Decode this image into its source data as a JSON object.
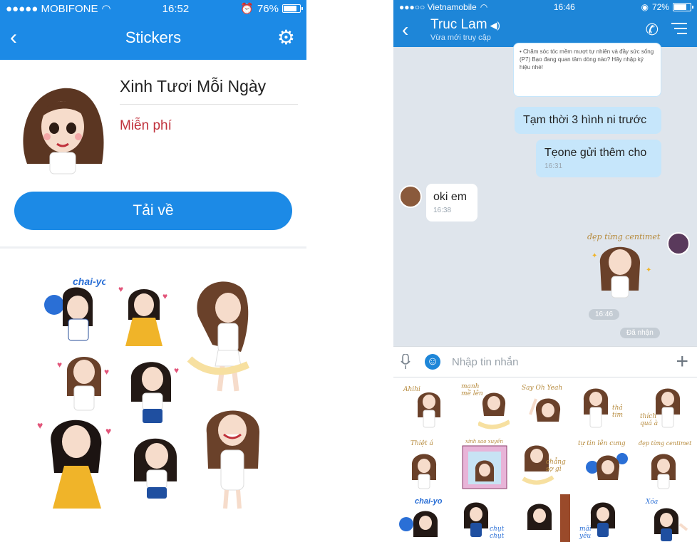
{
  "left_screen": {
    "status": {
      "carrier": "●●●●● MOBIFONE",
      "time": "16:52",
      "battery_text": "76%",
      "battery_level": 0.76
    },
    "header": {
      "title": "Stickers"
    },
    "pack": {
      "name": "Xinh Tươi Mỗi Ngày",
      "price": "Miễn phí"
    },
    "download_label": "Tải về",
    "preview_captions": [
      "chai-yo"
    ]
  },
  "right_screen": {
    "status": {
      "carrier": "●●●○○ Vietnamobile",
      "time": "16:46",
      "battery_text": "72%",
      "battery_level": 0.72
    },
    "header": {
      "contact_name": "Truc Lam",
      "subtitle": "Vừa mới truy cập"
    },
    "messages": {
      "m1_partial": "• Chăm sóc tóc mềm mượt tự nhiên và đầy sức sống (P7) Bạo đang quan tâm dòng nào? Hãy nhập ký hiệu nhé!",
      "m2": "Tạm thời 3 hình ni trước",
      "m3": "Tẹone gửi thêm cho",
      "m3_time": "16:31",
      "m4": "oki em",
      "m4_time": "16:38",
      "sticker_caption": "đẹp từng centimet",
      "sticker_time": "16:46",
      "status": "Đã nhận"
    },
    "input": {
      "placeholder": "Nhập tin nhắn"
    },
    "sticker_captions": [
      "Ahihi",
      "mạnh mẽ lên",
      "Say Oh Yeah",
      "thả tim",
      "thích quá à",
      "Thiệt á",
      "xinh sao xuyến",
      "chẳng sợ gì",
      "tự tin lên cưng",
      "đẹp từng centimet",
      "chai-yo",
      "chụt chụt",
      "mãi yêu",
      "Xóa"
    ]
  },
  "colors": {
    "brand_blue": "#1c8ae6",
    "price_red": "#c0323c",
    "bubble_out": "#c6e6fb",
    "chat_bg": "#dfe5ec"
  }
}
